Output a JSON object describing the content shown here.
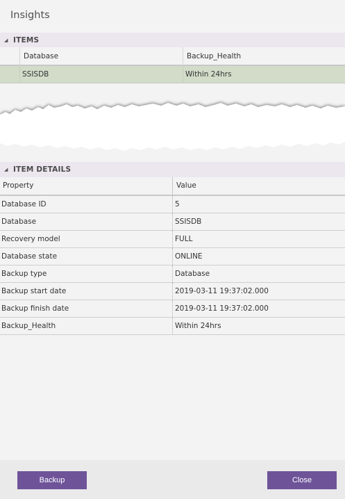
{
  "title": "Insights",
  "items_section": {
    "label": "ITEMS",
    "columns": [
      "Database",
      "Backup_Health"
    ],
    "rows": [
      {
        "database": "SSISDB",
        "backup_health": "Within 24hrs"
      }
    ]
  },
  "details_section": {
    "label": "ITEM DETAILS",
    "columns": [
      "Property",
      "Value"
    ],
    "rows": [
      {
        "property": "Database ID",
        "value": "5"
      },
      {
        "property": "Database",
        "value": "SSISDB"
      },
      {
        "property": "Recovery model",
        "value": "FULL"
      },
      {
        "property": "Database state",
        "value": "ONLINE"
      },
      {
        "property": "Backup type",
        "value": "Database"
      },
      {
        "property": "Backup start date",
        "value": "2019-03-11 19:37:02.000"
      },
      {
        "property": "Backup finish date",
        "value": "2019-03-11 19:37:02.000"
      },
      {
        "property": "Backup_Health",
        "value": "Within 24hrs"
      }
    ]
  },
  "footer": {
    "backup_label": "Backup",
    "close_label": "Close"
  },
  "colors": {
    "accent": "#6e5399",
    "section_header": "#ece6ee",
    "selected_row": "#d2dcc9"
  },
  "icons": {
    "section_toggle": "triangle-expanded-icon"
  }
}
